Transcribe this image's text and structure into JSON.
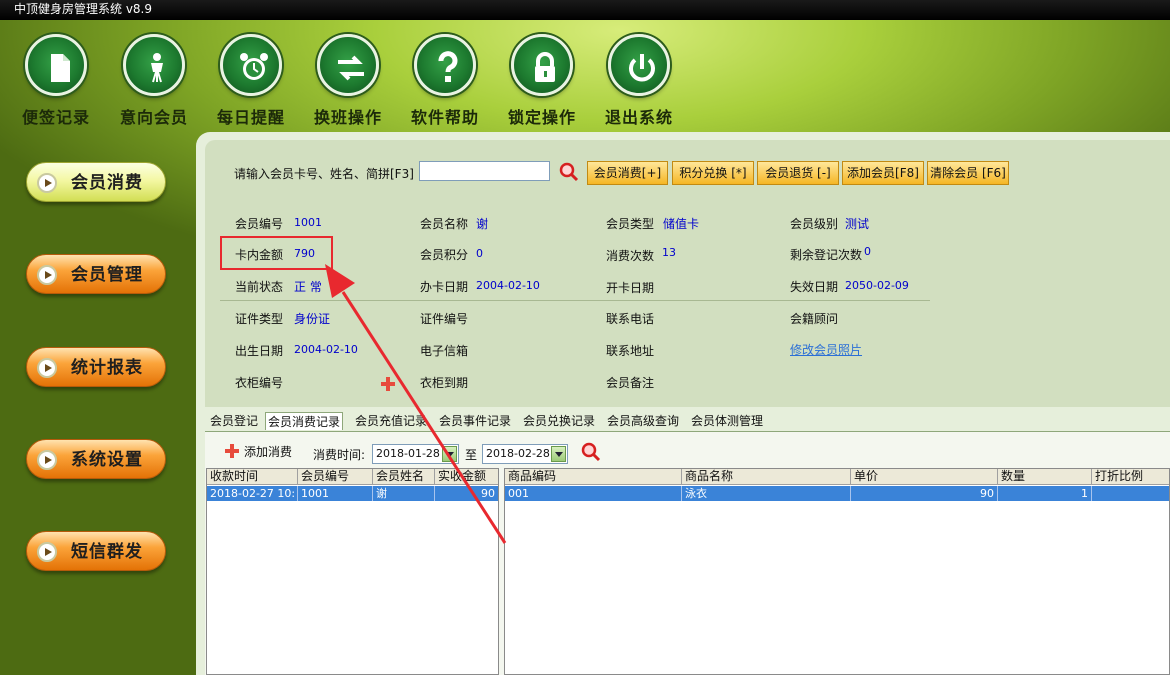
{
  "window": {
    "title": "中顶健身房管理系统  v8.9"
  },
  "toolbar": [
    {
      "label": "便签记录",
      "icon": "note-icon"
    },
    {
      "label": "意向会员",
      "icon": "person-icon"
    },
    {
      "label": "每日提醒",
      "icon": "alarm-clock-icon"
    },
    {
      "label": "换班操作",
      "icon": "switch-arrows-icon"
    },
    {
      "label": "软件帮助",
      "icon": "help-icon"
    },
    {
      "label": "锁定操作",
      "icon": "lock-icon"
    },
    {
      "label": "退出系统",
      "icon": "power-icon"
    }
  ],
  "sidebar": [
    {
      "label": "会员消费",
      "color": "#eef38a"
    },
    {
      "label": "会员管理",
      "color": "#f59a2a"
    },
    {
      "label": "统计报表",
      "color": "#f59a2a"
    },
    {
      "label": "系统设置",
      "color": "#f59a2a"
    },
    {
      "label": "短信群发",
      "color": "#f59a2a"
    }
  ],
  "search": {
    "label": "请输入会员卡号、姓名、简拼[F3]",
    "value": ""
  },
  "actions": {
    "consume": "会员消费[+]",
    "redeem": "积分兑换 [*]",
    "return": "会员退货 [-]",
    "add": "添加会员[F8]",
    "clear": "清除会员 [F6]"
  },
  "member": {
    "id_label": "会员编号",
    "id": "1001",
    "name_label": "会员名称",
    "name": "谢",
    "type_label": "会员类型",
    "type": "储值卡",
    "level_label": "会员级别",
    "level": "测试",
    "balance_label": "卡内金额",
    "balance": "790",
    "points_label": "会员积分",
    "points": "0",
    "consume_count_label": "消费次数",
    "consume_count": "13",
    "remaining_label": "剩余登记次数",
    "remaining": "0",
    "status_label": "当前状态",
    "status": "正 常",
    "open_date_label": "办卡日期",
    "open_date": "2004-02-10",
    "open_card_date_label": "开卡日期",
    "open_card_date": "",
    "expire_label": "失效日期",
    "expire": "2050-02-09",
    "cert_type_label": "证件类型",
    "cert_type": "身份证",
    "cert_no_label": "证件编号",
    "cert_no": "",
    "phone_label": "联系电话",
    "phone": "",
    "advisor_label": "会籍顾问",
    "advisor": "",
    "birth_label": "出生日期",
    "birth": "2004-02-10",
    "email_label": "电子信箱",
    "email": "",
    "address_label": "联系地址",
    "address": "",
    "photo_link": "修改会员照片",
    "locker_label": "衣柜编号",
    "locker": "",
    "locker_expire_label": "衣柜到期",
    "locker_expire": "",
    "remark_label": "会员备注",
    "remark": ""
  },
  "tabs": [
    "会员登记",
    "会员消费记录",
    "会员充值记录",
    "会员事件记录",
    "会员兑换记录",
    "会员高级查询",
    "会员体测管理"
  ],
  "active_tab": "会员消费记录",
  "records": {
    "add_label": "添加消费",
    "time_label": "消费时间:",
    "date_from": "2018-01-28",
    "to_label": "至",
    "date_to": "2018-02-28",
    "left_columns": [
      "收款时间",
      "会员编号",
      "会员姓名",
      "实收金额"
    ],
    "left_rows": [
      [
        "2018-02-27 10:",
        "1001",
        "谢",
        "90"
      ]
    ],
    "right_columns": [
      "商品编码",
      "商品名称",
      "单价",
      "数量",
      "打折比例"
    ],
    "right_rows": [
      [
        "001",
        "泳衣",
        "90",
        "1",
        ""
      ]
    ]
  },
  "colors": {
    "highlight": "#e8292f",
    "selection": "#3a83d8",
    "value_text": "#0000cc"
  }
}
